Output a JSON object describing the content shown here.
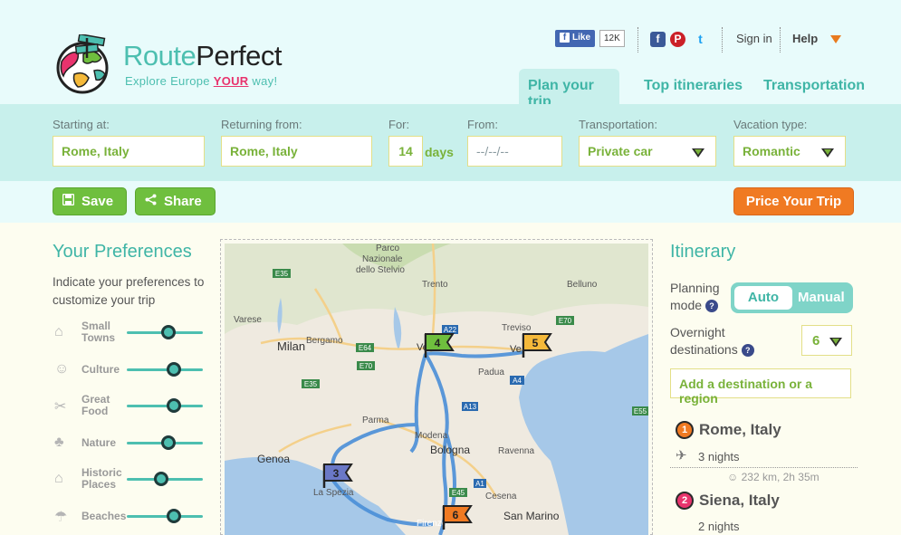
{
  "brand": {
    "name_part1": "Route",
    "name_part2": "Perfect",
    "tagline_pre": "Explore Europe",
    "tagline_your": "YOUR",
    "tagline_post": "way!"
  },
  "social": {
    "like_label": "Like",
    "like_count": "12K",
    "facebook_glyph": "f",
    "pinterest_glyph": "P",
    "twitter_glyph": "t"
  },
  "header": {
    "signin": "Sign in",
    "help": "Help",
    "tabs": [
      {
        "label": "Plan your trip",
        "active": true
      },
      {
        "label": "Top itineraries"
      },
      {
        "label": "Transportation"
      }
    ]
  },
  "search": {
    "starting_label": "Starting at:",
    "starting_value": "Rome, Italy",
    "returning_label": "Returning from:",
    "returning_value": "Rome, Italy",
    "for_label": "For:",
    "for_value": "14",
    "days_label": "days",
    "from_label": "From:",
    "from_placeholder": "--/--/--",
    "transport_label": "Transportation:",
    "transport_value": "Private car",
    "vacation_label": "Vacation type:",
    "vacation_value": "Romantic"
  },
  "actions": {
    "save": "Save",
    "share": "Share",
    "price": "Price Your Trip"
  },
  "preferences": {
    "title": "Your Preferences",
    "description": "Indicate your preferences to customize your trip",
    "items": [
      {
        "label": "Small Towns",
        "icon": "town-icon",
        "value": 0.55
      },
      {
        "label": "Culture",
        "icon": "culture-icon",
        "value": 0.62
      },
      {
        "label": "Great Food",
        "icon": "food-icon",
        "value": 0.62
      },
      {
        "label": "Nature",
        "icon": "nature-icon",
        "value": 0.55
      },
      {
        "label": "Historic Places",
        "icon": "museum-icon",
        "value": 0.45
      },
      {
        "label": "Beaches",
        "icon": "beach-icon",
        "value": 0.62
      }
    ]
  },
  "map": {
    "labels": {
      "parco": "Parco",
      "nazionale": "Nazionale",
      "stelvio": "dello Stelvio",
      "trento": "Trento",
      "belluno": "Belluno",
      "treviso": "Treviso",
      "varese": "Varese",
      "bergamo": "Bergamo",
      "milan": "Milan",
      "verona": "Verona",
      "padua": "Padua",
      "ve": "Ve",
      "parma": "Parma",
      "modena": "Modena",
      "bologna": "Bologna",
      "genoa": "Genoa",
      "laspezia": "La Spezia",
      "ravenna": "Ravenna",
      "cesena": "Cesena",
      "sanmarino": "San Marino",
      "firenze": "Firenze",
      "e35a": "E35",
      "e35b": "E35",
      "e64": "E64",
      "e70a": "E70",
      "e70b": "E70",
      "e45": "E45",
      "e55": "E55",
      "a4": "A4",
      "a22": "A22",
      "a13": "A13",
      "a1": "A1"
    },
    "flags": [
      {
        "num": "3",
        "color": "#6a78c6"
      },
      {
        "num": "4",
        "color": "#6fbf3e"
      },
      {
        "num": "5",
        "color": "#f5b93a"
      },
      {
        "num": "6",
        "color": "#f07a22"
      }
    ]
  },
  "itinerary": {
    "title": "Itinerary",
    "planning_label_1": "Planning",
    "planning_label_2": "mode",
    "mode_auto": "Auto",
    "mode_manual": "Manual",
    "overnight_label_1": "Overnight",
    "overnight_label_2": "destinations",
    "overnight_value": "6",
    "add_destination": "Add a destination or a region",
    "leg_info": "232 km, 2h 35m",
    "stops": [
      {
        "num": "1",
        "name": "Rome, Italy",
        "nights": "3 nights",
        "color": "#f07a22"
      },
      {
        "num": "2",
        "name": "Siena, Italy",
        "nights": "2 nights",
        "color": "#e8336d"
      }
    ]
  },
  "colors": {
    "teal": "#3fb5a6",
    "green": "#6fbf3e",
    "orange": "#f07a22",
    "pink": "#e8336d"
  }
}
